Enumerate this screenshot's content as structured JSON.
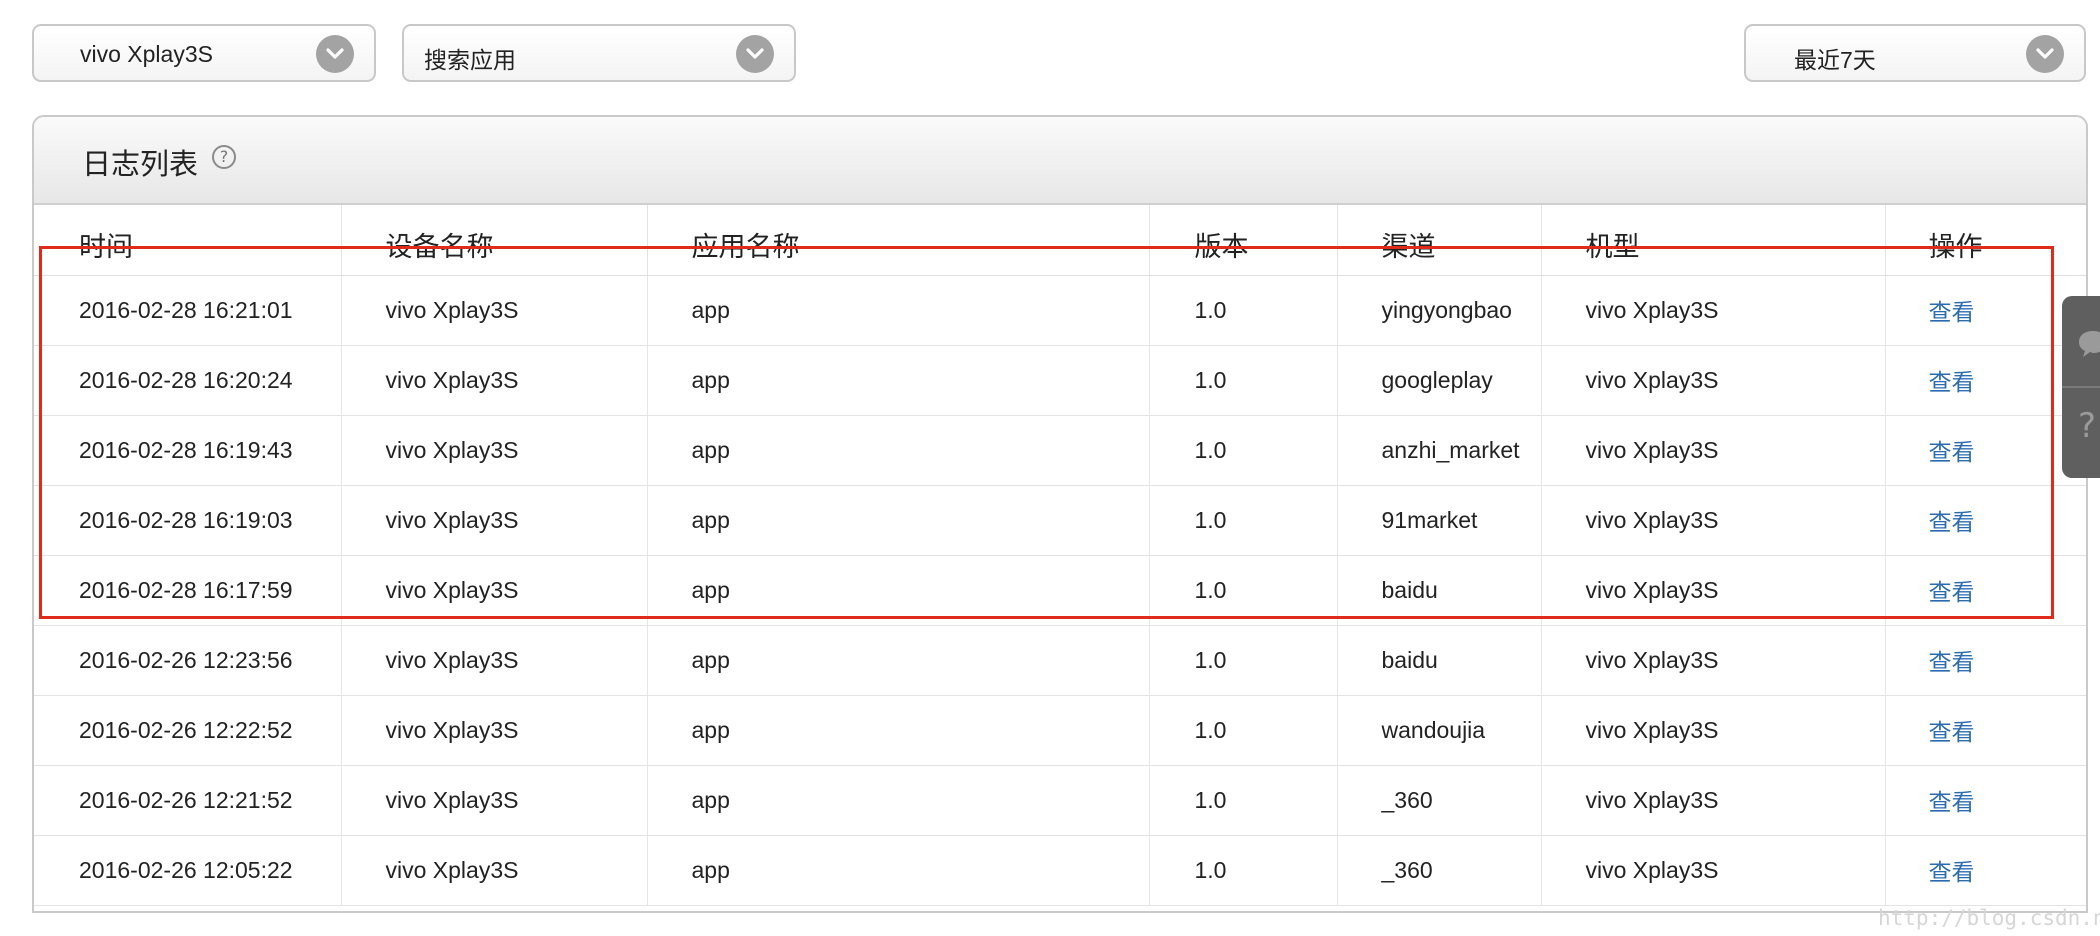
{
  "filters": {
    "device": "vivo Xplay3S",
    "app": "搜索应用",
    "range": "最近7天"
  },
  "panel": {
    "title": "日志列表",
    "help_symbol": "?"
  },
  "table": {
    "headers": [
      "时间",
      "设备名称",
      "应用名称",
      "版本",
      "渠道",
      "机型",
      "操作"
    ],
    "rows": [
      {
        "time": "2016-02-28 16:21:01",
        "device": "vivo Xplay3S",
        "app": "app",
        "version": "1.0",
        "channel": "yingyongbao",
        "model": "vivo Xplay3S",
        "action": "查看"
      },
      {
        "time": "2016-02-28 16:20:24",
        "device": "vivo Xplay3S",
        "app": "app",
        "version": "1.0",
        "channel": "googleplay",
        "model": "vivo Xplay3S",
        "action": "查看"
      },
      {
        "time": "2016-02-28 16:19:43",
        "device": "vivo Xplay3S",
        "app": "app",
        "version": "1.0",
        "channel": "anzhi_market",
        "model": "vivo Xplay3S",
        "action": "查看"
      },
      {
        "time": "2016-02-28 16:19:03",
        "device": "vivo Xplay3S",
        "app": "app",
        "version": "1.0",
        "channel": "91market",
        "model": "vivo Xplay3S",
        "action": "查看"
      },
      {
        "time": "2016-02-28 16:17:59",
        "device": "vivo Xplay3S",
        "app": "app",
        "version": "1.0",
        "channel": "baidu",
        "model": "vivo Xplay3S",
        "action": "查看"
      },
      {
        "time": "2016-02-26 12:23:56",
        "device": "vivo Xplay3S",
        "app": "app",
        "version": "1.0",
        "channel": "baidu",
        "model": "vivo Xplay3S",
        "action": "查看"
      },
      {
        "time": "2016-02-26 12:22:52",
        "device": "vivo Xplay3S",
        "app": "app",
        "version": "1.0",
        "channel": "wandoujia",
        "model": "vivo Xplay3S",
        "action": "查看"
      },
      {
        "time": "2016-02-26 12:21:52",
        "device": "vivo Xplay3S",
        "app": "app",
        "version": "1.0",
        "channel": "_360",
        "model": "vivo Xplay3S",
        "action": "查看"
      },
      {
        "time": "2016-02-26 12:05:22",
        "device": "vivo Xplay3S",
        "app": "app",
        "version": "1.0",
        "channel": "_360",
        "model": "vivo Xplay3S",
        "action": "查看"
      }
    ]
  },
  "side_tab": {
    "icons": [
      "chat-icon",
      "question-icon"
    ],
    "question_symbol": "?"
  },
  "watermark": "http://blog.csdn.net/",
  "colors": {
    "highlight": "#e02a1a",
    "link": "#2b6cb0",
    "arrow_button": "#a3a3a3",
    "side_tab": "#5f5f5f"
  }
}
